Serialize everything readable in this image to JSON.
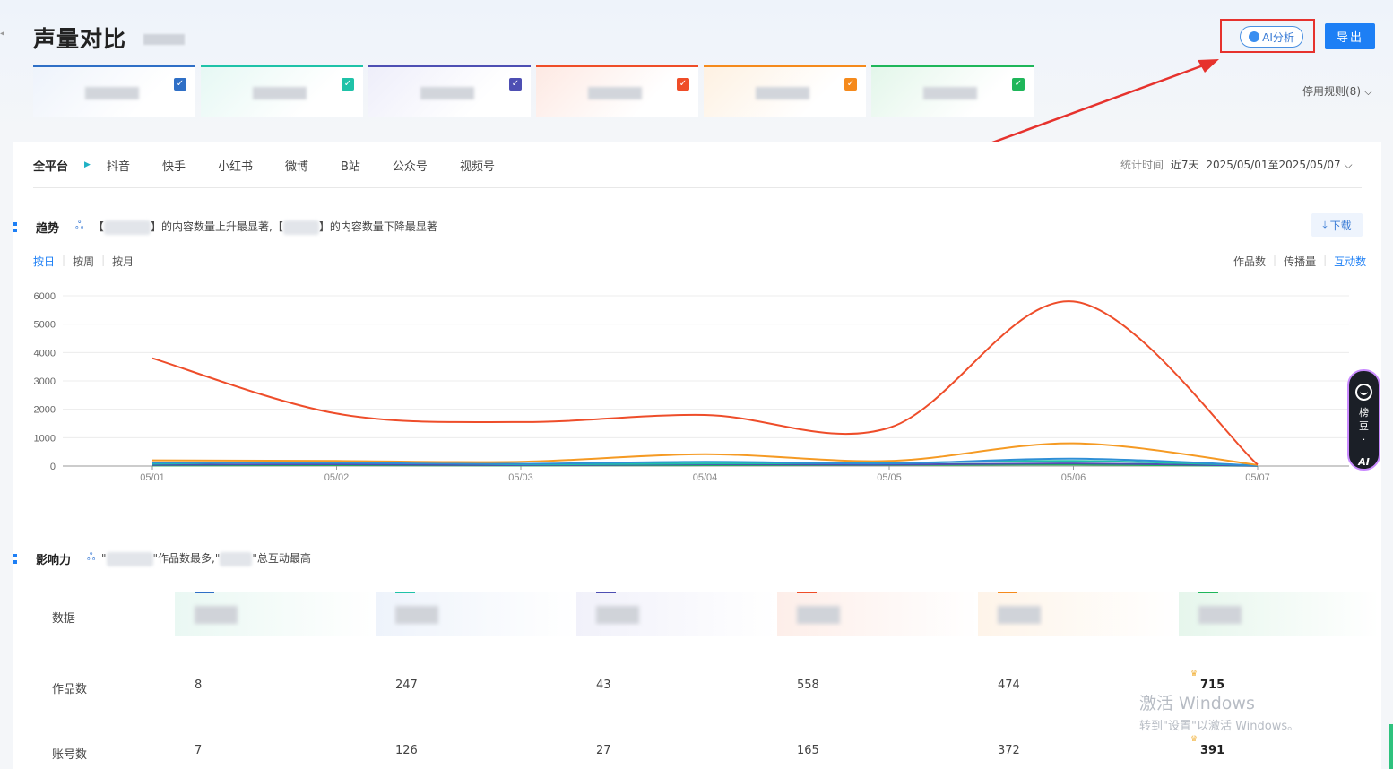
{
  "header": {
    "title": "声量对比",
    "ai_button": "AI分析",
    "export_button": "导出",
    "stop_rules": "停用规则(8) ⌵"
  },
  "brand_cards": [
    {
      "color": "#2f6fc6"
    },
    {
      "color": "#1fc2a8"
    },
    {
      "color": "#4e4fb3"
    },
    {
      "color": "#ef4d28"
    },
    {
      "color": "#f58a1c"
    },
    {
      "color": "#1fb65a"
    }
  ],
  "platform_tabs": [
    "全平台",
    "抖音",
    "快手",
    "小红书",
    "微博",
    "B站",
    "公众号",
    "视频号"
  ],
  "stat_time": {
    "label": "统计时间",
    "range": "近7天",
    "dates": "2025/05/01至2025/05/07 ⌵"
  },
  "trend": {
    "title": "趋势",
    "desc_bracket_open": "【",
    "desc_part1": "】的内容数量上升最显著,【",
    "desc_part2": "】的内容数量下降最显著",
    "download": "下载",
    "granularity": [
      "按日",
      "按周",
      "按月"
    ],
    "metrics": [
      "作品数",
      "传播量",
      "互动数"
    ]
  },
  "chart_data": {
    "type": "line",
    "categories": [
      "05/01",
      "05/02",
      "05/03",
      "05/04",
      "05/05",
      "05/06",
      "05/07"
    ],
    "ylim": [
      0,
      6000
    ],
    "yticks": [
      0,
      1000,
      2000,
      3000,
      4000,
      5000,
      6000
    ],
    "series": [
      {
        "color": "#ee4d2a",
        "values": [
          3800,
          1850,
          1550,
          1800,
          1350,
          5800,
          50
        ]
      },
      {
        "color": "#f59a23",
        "values": [
          200,
          180,
          150,
          420,
          180,
          800,
          40
        ]
      },
      {
        "color": "#2f8fd6",
        "values": [
          120,
          110,
          80,
          150,
          90,
          260,
          20
        ]
      },
      {
        "color": "#1fc2a8",
        "values": [
          80,
          150,
          60,
          90,
          110,
          180,
          30
        ]
      },
      {
        "color": "#4e4fb3",
        "values": [
          40,
          60,
          30,
          60,
          50,
          90,
          10
        ]
      },
      {
        "color": "#1fb65a",
        "values": [
          20,
          30,
          20,
          30,
          40,
          50,
          5
        ]
      }
    ],
    "grid": true
  },
  "influence": {
    "title": "影响力",
    "desc_quote_open": "\"",
    "desc_part1": "\"作品数最多,\"",
    "desc_part2": "\"总互动最高",
    "row_labels": [
      "数据",
      "作品数",
      "账号数"
    ],
    "works": [
      "8",
      "247",
      "43",
      "558",
      "474",
      "715"
    ],
    "accounts": [
      "7",
      "126",
      "27",
      "165",
      "372",
      "391"
    ]
  },
  "float_widget": {
    "line1": "榜",
    "line2": "豆",
    "dot": "·",
    "ai": "AI"
  },
  "watermark": {
    "line1": "激活 Windows",
    "line2": "转到\"设置\"以激活 Windows。"
  }
}
